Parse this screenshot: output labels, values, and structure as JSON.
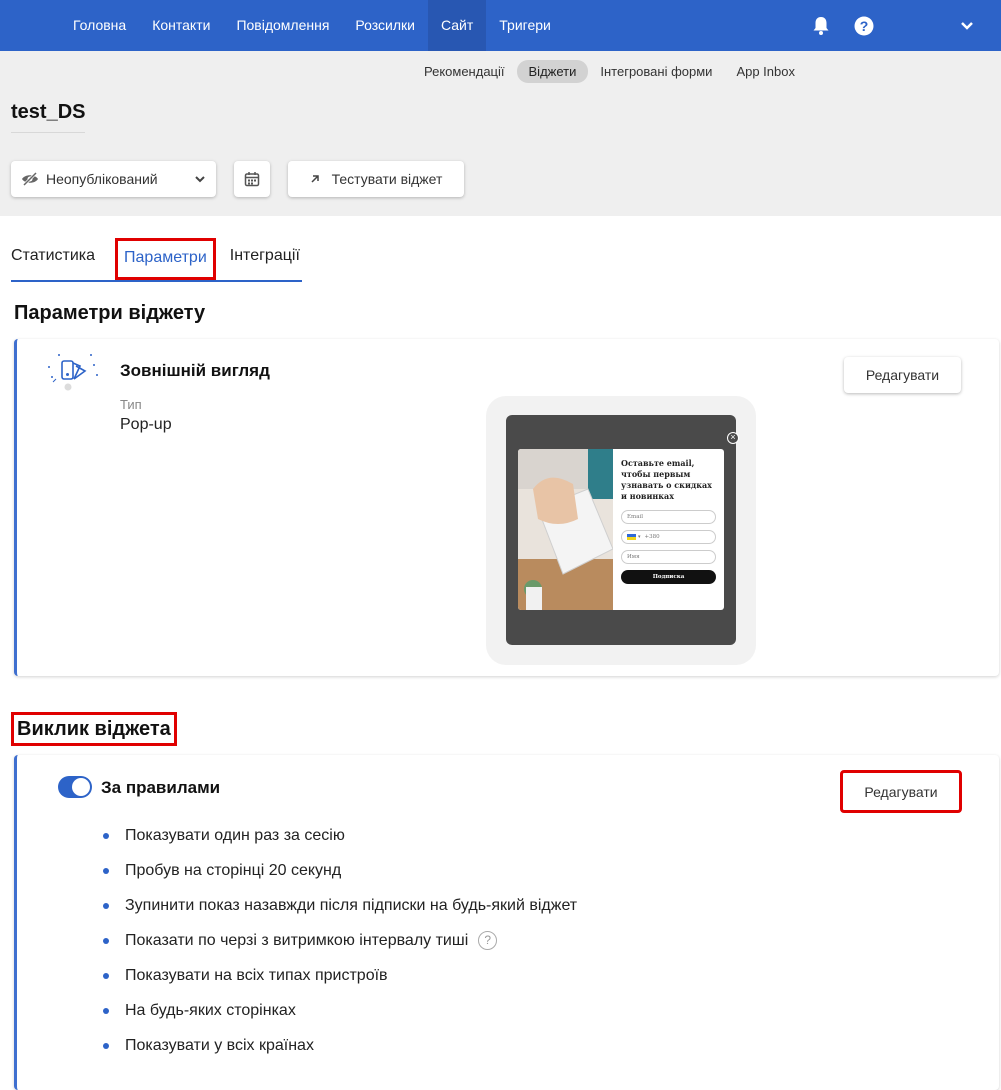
{
  "topnav": {
    "items": [
      {
        "label": "Головна"
      },
      {
        "label": "Контакти"
      },
      {
        "label": "Повідомлення"
      },
      {
        "label": "Розсилки"
      },
      {
        "label": "Сайт"
      },
      {
        "label": "Тригери"
      }
    ],
    "active": "Сайт",
    "icons": [
      "bell-icon",
      "help-icon",
      "chevron-down-icon"
    ]
  },
  "subnav": {
    "items": [
      {
        "label": "Рекомендації"
      },
      {
        "label": "Віджети"
      },
      {
        "label": "Інтегровані форми"
      },
      {
        "label": "App Inbox"
      }
    ],
    "active": "Віджети"
  },
  "page": {
    "title": "test_DS"
  },
  "toolbar": {
    "status_label": "Неопублікований",
    "test_label": "Тестувати віджет"
  },
  "tabs": [
    {
      "label": "Статистика"
    },
    {
      "label": "Параметри"
    },
    {
      "label": "Інтеграції"
    }
  ],
  "params": {
    "section_title": "Параметри віджету",
    "appearance_heading": "Зовнішній вигляд",
    "type_label": "Тип",
    "type_value": "Pop-up",
    "edit_label": "Редагувати"
  },
  "preview": {
    "title": "Оставьте email, чтобы первым узнавать о скидках и новинках",
    "email_placeholder": "Email",
    "phone_placeholder": "+380",
    "name_placeholder": "Имя",
    "submit_label": "Подписка"
  },
  "trigger": {
    "section_title": "Виклик віджета",
    "rules_heading": "За правилами",
    "edit_label": "Редагувати",
    "toggle_on": true,
    "rules": [
      "Показувати один раз за сесію",
      "Пробув на сторінці 20 секунд",
      "Зупинити показ назавжди після підписки на будь-який віджет",
      "Показати по черзі з витримкою інтервалу тиші",
      "Показувати на всіх типах пристроїв",
      "На будь-яких сторінках",
      "Показувати у всіх країнах"
    ]
  },
  "colors": {
    "primary": "#2d63c8",
    "highlight": "#e00000"
  }
}
